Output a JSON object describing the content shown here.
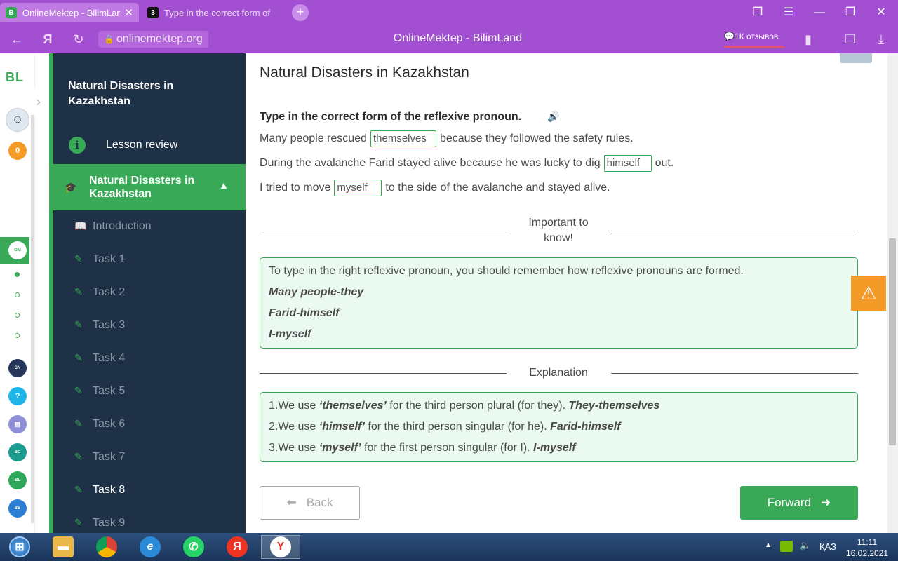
{
  "browser": {
    "tabs": [
      {
        "label": "OnlineMektep - BilimLand",
        "favicon": "B",
        "active": true
      },
      {
        "label": "Type in the correct form of",
        "favicon": "3",
        "active": false
      }
    ],
    "url": "onlinemektep.org",
    "page_title": "OnlineMektep - BilimLand",
    "reviews": "1К отзывов",
    "accent_color": "#a34fd2"
  },
  "rail": {
    "logo": "BL",
    "score": "0"
  },
  "sidebar": {
    "title": "Natural Disasters in Kazakhstan",
    "lesson_review": "Lesson review",
    "module": "Natural Disasters in Kazakhstan",
    "items": [
      {
        "label": "Introduction",
        "icon": "book-icon"
      },
      {
        "label": "Task 1",
        "icon": "edit-icon"
      },
      {
        "label": "Task 2",
        "icon": "edit-icon"
      },
      {
        "label": "Task 3",
        "icon": "edit-icon"
      },
      {
        "label": "Task 4",
        "icon": "edit-icon"
      },
      {
        "label": "Task 5",
        "icon": "edit-icon"
      },
      {
        "label": "Task 6",
        "icon": "edit-icon"
      },
      {
        "label": "Task 7",
        "icon": "edit-icon"
      },
      {
        "label": "Task 8",
        "icon": "edit-icon",
        "current": true
      },
      {
        "label": "Task 9",
        "icon": "edit-icon"
      }
    ],
    "active_color": "#3aa957"
  },
  "main": {
    "title": "Natural Disasters in Kazakhstan",
    "instruction": "Type in the correct form of the reflexive pronoun.",
    "sentences": [
      {
        "before": "Many people rescued",
        "answer": "themselves",
        "after": "because they followed the safety rules."
      },
      {
        "before": "During the avalanche Farid stayed alive because he was lucky to dig",
        "answer": "himself",
        "after": "out."
      },
      {
        "before": "I tried to move",
        "answer": "myself",
        "after": "to the side of the avalanche and stayed alive."
      }
    ],
    "important_heading": "Important to know!",
    "important_lines": [
      {
        "text": "To type in the right reflexive pronoun, you should remember how reflexive pronouns are formed."
      },
      {
        "text": "Many people-they"
      },
      {
        "text": "Farid-himself"
      },
      {
        "text": "I-myself"
      }
    ],
    "explanation_heading": "Explanation",
    "explanation_lines": [
      {
        "a": "1.We use ",
        "b": "‘themselves’",
        "c": " for the third person plural (for they). ",
        "d": "They-themselves"
      },
      {
        "a": "2.We use ",
        "b": "‘himself’",
        "c": " for the third person singular (for he). ",
        "d": "Farid-himself"
      },
      {
        "a": "3.We use ",
        "b": "‘myself’",
        "c": " for the first person singular (for I). ",
        "d": "I-myself"
      }
    ],
    "back_label": "Back",
    "forward_label": "Forward"
  },
  "taskbar": {
    "lang": "ҚАЗ",
    "time": "11:11",
    "date": "16.02.2021"
  }
}
